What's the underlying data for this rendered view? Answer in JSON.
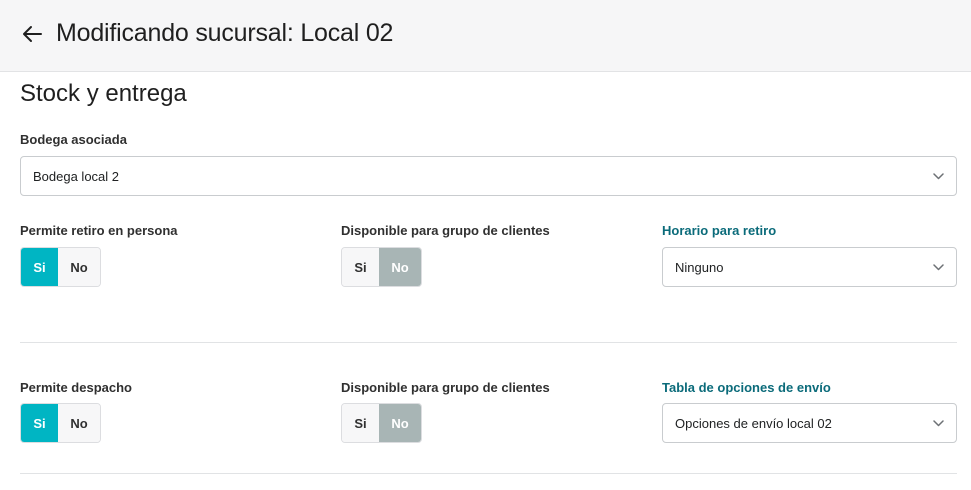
{
  "header": {
    "title": "Modificando sucursal: Local 02"
  },
  "section": {
    "title": "Stock y entrega"
  },
  "warehouse": {
    "label": "Bodega asociada",
    "value": "Bodega local 2"
  },
  "pickup": {
    "label": "Permite retiro en persona",
    "yes_label": "Si",
    "no_label": "No",
    "selected": "Si",
    "group_label": "Disponible para grupo de clientes",
    "group_yes_label": "Si",
    "group_no_label": "No",
    "group_selected": "No",
    "schedule_label": "Horario para retiro",
    "schedule_value": "Ninguno"
  },
  "dispatch": {
    "label": "Permite despacho",
    "yes_label": "Si",
    "no_label": "No",
    "selected": "Si",
    "group_label": "Disponible para grupo de clientes",
    "group_yes_label": "Si",
    "group_no_label": "No",
    "group_selected": "No",
    "shipping_label": "Tabla de opciones de envío",
    "shipping_value": "Opciones de envío local 02"
  },
  "colors": {
    "accent": "#00b5c3",
    "link": "#0b6b7a",
    "inactive_selected": "#a8b5b5"
  },
  "icons": {
    "back": "arrow-left-icon",
    "select": "chevron-down-icon"
  }
}
